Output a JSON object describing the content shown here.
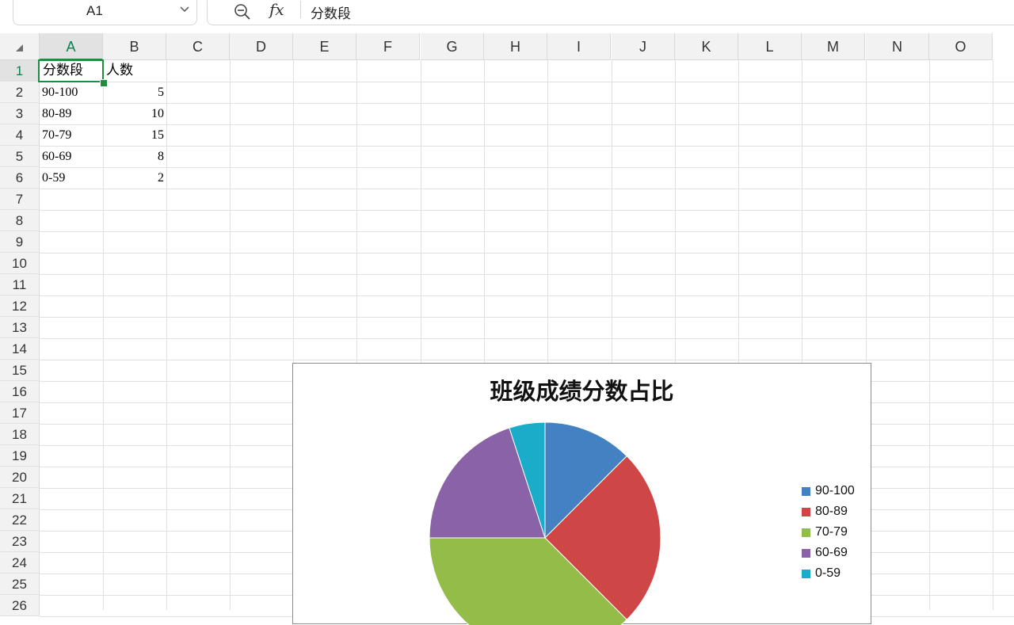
{
  "formula_bar": {
    "cell_ref": "A1",
    "content": "分数段",
    "fx_label": "fx"
  },
  "columns": [
    "A",
    "B",
    "C",
    "D",
    "E",
    "F",
    "G",
    "H",
    "I",
    "J",
    "K",
    "L",
    "M",
    "N",
    "O"
  ],
  "rows": [
    "1",
    "2",
    "3",
    "4",
    "5",
    "6",
    "7",
    "8",
    "9",
    "10",
    "11",
    "12",
    "13",
    "14",
    "15",
    "16",
    "17",
    "18",
    "19",
    "20",
    "21",
    "22",
    "23",
    "24",
    "25",
    "26"
  ],
  "cells": {
    "A1": "分数段",
    "B1": "人数",
    "A2": "90-100",
    "B2": "5",
    "A3": "80-89",
    "B3": "10",
    "A4": "70-79",
    "B4": "15",
    "A5": "60-69",
    "B5": "8",
    "A6": "0-59",
    "B6": "2"
  },
  "chart_data": {
    "type": "pie",
    "title": "班级成绩分数占比",
    "categories": [
      "90-100",
      "80-89",
      "70-79",
      "60-69",
      "0-59"
    ],
    "values": [
      5,
      10,
      15,
      8,
      2
    ],
    "colors": [
      "#4481c2",
      "#cf4646",
      "#94bc48",
      "#8a62a8",
      "#1aacc8"
    ],
    "legend_position": "right"
  }
}
